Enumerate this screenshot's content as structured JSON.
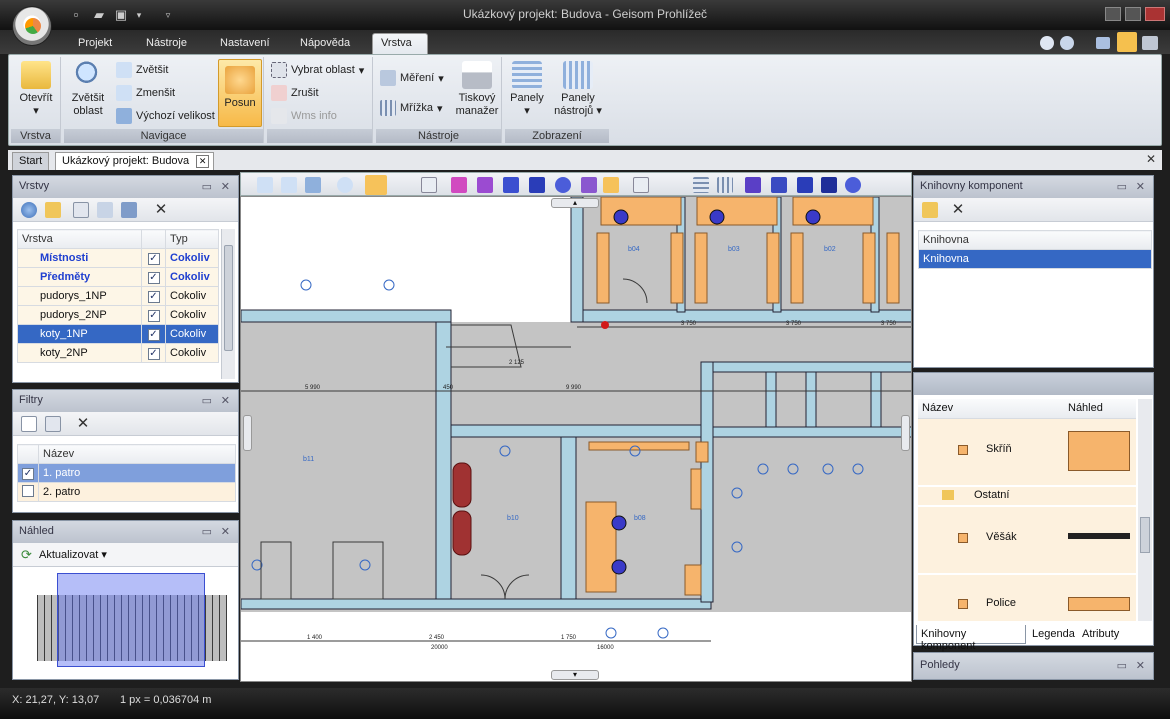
{
  "window": {
    "title": "Ukázkový projekt: Budova - Geisom Prohlížeč"
  },
  "quick_access": {
    "icons": [
      "new-icon",
      "open-icon",
      "save-icon",
      "dropdown-icon"
    ]
  },
  "ribbon_tabs": [
    "Projekt",
    "Nástroje",
    "Nastavení",
    "Nápověda",
    "Vrstva"
  ],
  "active_ribbon_tab": "Vrstva",
  "ribbon": {
    "vrstva_group": {
      "label": "Vrstva",
      "open_label": "Otevřít"
    },
    "navigace_group": {
      "label": "Navigace",
      "zoom_area": "Zvětšit oblast",
      "zoom_in": "Zvětšit",
      "zoom_out": "Zmenšit",
      "default_size": "Výchozí velikost",
      "pan": "Posun"
    },
    "select_group": {
      "select_area": "Vybrat oblast",
      "cancel": "Zrušit",
      "wms_info": "Wms info"
    },
    "nastroje_group": {
      "label": "Nástroje",
      "measure": "Měření",
      "grid": "Mřížka",
      "print_manager": "Tiskový manažer"
    },
    "zobrazeni_group": {
      "label": "Zobrazení",
      "panels": "Panely",
      "toolbars": "Panely nástrojů"
    }
  },
  "doc_tabs": {
    "start": "Start",
    "project": "Ukázkový projekt: Budova"
  },
  "layers_panel": {
    "title": "Vrstvy",
    "columns": [
      "Vrstva",
      "",
      "Typ"
    ],
    "rows": [
      {
        "name": "Místnosti",
        "checked": true,
        "type": "Cokoliv",
        "bold": true
      },
      {
        "name": "Předměty",
        "checked": true,
        "type": "Cokoliv",
        "bold": true
      },
      {
        "name": "pudorys_1NP",
        "checked": true,
        "type": "Cokoliv",
        "bold": false
      },
      {
        "name": "pudorys_2NP",
        "checked": true,
        "type": "Cokoliv",
        "bold": false
      },
      {
        "name": "koty_1NP",
        "checked": true,
        "type": "Cokoliv",
        "bold": false,
        "selected": true
      },
      {
        "name": "koty_2NP",
        "checked": true,
        "type": "Cokoliv",
        "bold": false
      }
    ]
  },
  "filters_panel": {
    "title": "Filtry",
    "column": "Název",
    "rows": [
      {
        "name": "1. patro",
        "checked": true,
        "selected": true
      },
      {
        "name": "2. patro",
        "checked": false
      }
    ]
  },
  "preview_panel": {
    "title": "Náhled",
    "refresh": "Aktualizovat"
  },
  "library_panel": {
    "title": "Knihovny komponent",
    "column": "Knihovna",
    "rows": [
      "Knihovna"
    ]
  },
  "components_panel": {
    "columns": [
      "Název",
      "Náhled"
    ],
    "items": [
      {
        "name": "Skříň"
      },
      {
        "name": "Ostatní",
        "folder": true
      },
      {
        "name": "Věšák"
      },
      {
        "name": "Police"
      }
    ],
    "tabs": [
      "Knihovny komponent",
      "Legenda",
      "Atributy"
    ]
  },
  "views_panel": {
    "title": "Pohledy"
  },
  "map": {
    "rooms": [
      "b04",
      "b03",
      "b02",
      "b11",
      "b10",
      "b08"
    ],
    "dims": [
      "5 990",
      "9 990",
      "2 125",
      "3 750",
      "3 750",
      "3 750",
      "450",
      "1 400",
      "2 450",
      "1 750",
      "20000",
      "16000"
    ]
  },
  "status": {
    "coords": "X: 21,27, Y: 13,07",
    "scale": "1 px = 0,036704 m"
  },
  "colors": {
    "accent": "#3c78c8",
    "selection": "#3568c4",
    "furniture": "#f6b46c",
    "wall": "#aed3e2",
    "floor": "#c3c3c3"
  }
}
